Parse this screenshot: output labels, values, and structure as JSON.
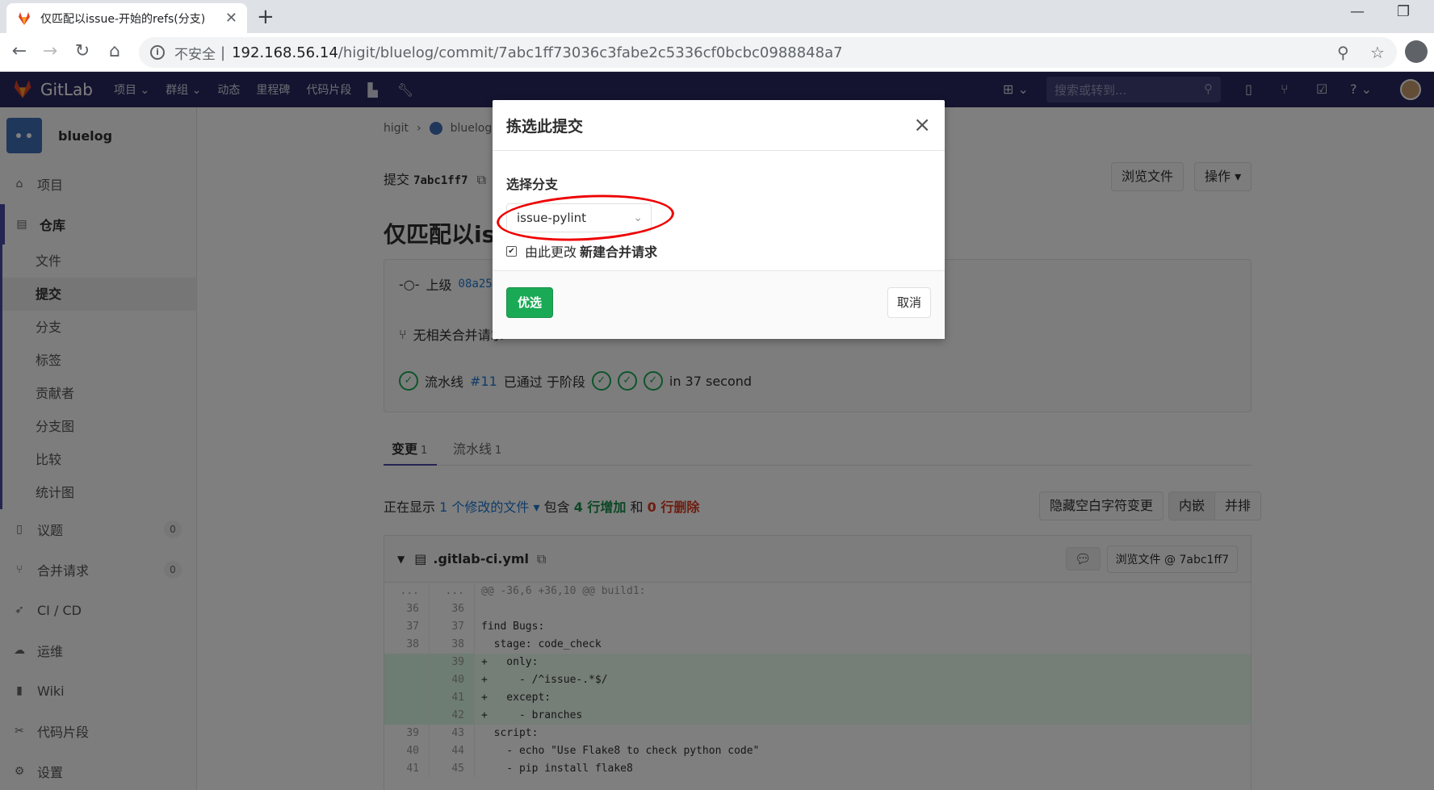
{
  "browser": {
    "tab_title": "仅匹配以issue-开始的refs(分支)",
    "tab_close": "✕",
    "new_tab": "+",
    "url_insecure": "不安全",
    "url_sep": "|",
    "url_host": "192.168.56.14",
    "url_path": "/higit/bluelog/commit/7abc1ff73036c3fabe2c5336cf0bcbc0988848a7"
  },
  "gitlab_header": {
    "brand": "GitLab",
    "nav": [
      "项目 ⌄",
      "群组 ⌄",
      "动态",
      "里程碑",
      "代码片段"
    ],
    "search_placeholder": "搜索或转到..."
  },
  "sidebar": {
    "project_name": "bluelog",
    "items": {
      "project": "项目",
      "repository": "仓库",
      "issues": "议题",
      "issues_count": "0",
      "merge_requests": "合并请求",
      "mr_count": "0",
      "cicd": "CI / CD",
      "ops": "运维",
      "wiki": "Wiki",
      "snippets": "代码片段",
      "settings": "设置"
    },
    "repo_sub": [
      "文件",
      "提交",
      "分支",
      "标签",
      "贡献者",
      "分支图",
      "比较",
      "统计图"
    ]
  },
  "page": {
    "breadcrumb_group": "higit",
    "breadcrumb_project": "bluelog",
    "commit_label": "提交",
    "commit_sha": "7abc1ff7",
    "browse_files": "浏览文件",
    "actions": "操作 ▾",
    "title": "仅匹配以iss",
    "parent_label": "上级",
    "parent_sha": "08a258",
    "no_mr": "无相关合并请求",
    "pipeline_label": "流水线",
    "pipeline_id": "#11",
    "pipeline_status": "已通过 于阶段",
    "pipeline_time": "in 37 second",
    "tab_changes": "变更",
    "tab_changes_count": "1",
    "tab_pipelines": "流水线",
    "tab_pipelines_count": "1",
    "summary_prefix": "正在显示",
    "summary_files": "1 个修改的文件 ▾",
    "summary_mid": "包含",
    "summary_add": "4 行增加",
    "summary_and": "和",
    "summary_del": "0 行删除",
    "hide_ws": "隐藏空白字符变更",
    "inline": "内嵌",
    "side_by_side": "并排",
    "diff_file": ".gitlab-ci.yml",
    "diff_browse": "浏览文件 @ 7abc1ff7"
  },
  "diff_lines": [
    {
      "old": "...",
      "new": "...",
      "code": "@@ -36,6 +36,10 @@ build1:",
      "type": "meta"
    },
    {
      "old": "36",
      "new": "36",
      "code": "",
      "type": "ctx"
    },
    {
      "old": "37",
      "new": "37",
      "code": "find Bugs:",
      "type": "ctx"
    },
    {
      "old": "38",
      "new": "38",
      "code": "  stage: code_check",
      "type": "ctx"
    },
    {
      "old": "",
      "new": "39",
      "code": "+   only:",
      "type": "add"
    },
    {
      "old": "",
      "new": "40",
      "code": "+     - /^issue-.*$/",
      "type": "add"
    },
    {
      "old": "",
      "new": "41",
      "code": "+   except:",
      "type": "add"
    },
    {
      "old": "",
      "new": "42",
      "code": "+     - branches",
      "type": "add"
    },
    {
      "old": "39",
      "new": "43",
      "code": "  script:",
      "type": "ctx"
    },
    {
      "old": "40",
      "new": "44",
      "code": "    - echo \"Use Flake8 to check python code\"",
      "type": "ctx"
    },
    {
      "old": "41",
      "new": "45",
      "code": "    - pip install flake8",
      "type": "ctx"
    }
  ],
  "modal": {
    "title": "拣选此提交",
    "close": "×",
    "branch_label": "选择分支",
    "branch_value": "issue-pylint",
    "checkbox_checked": true,
    "checkbox_text": "由此更改",
    "checkbox_bold": "新建合并请求",
    "submit": "优选",
    "cancel": "取消"
  },
  "colors": {
    "header_bg": "#292961",
    "accent_green": "#1aaa55",
    "annotation_red": "#e00000"
  }
}
